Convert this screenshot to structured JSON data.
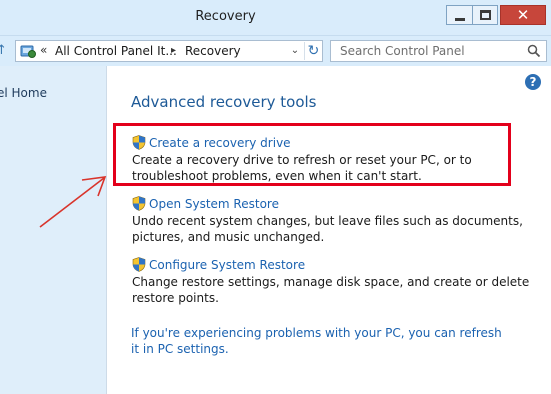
{
  "window": {
    "title": "Recovery",
    "controls": {
      "minimize": "—",
      "maximize": "□",
      "close": "✕"
    }
  },
  "address_bar": {
    "prefix": "«",
    "segments": [
      "All Control Panel It...",
      "Recovery"
    ],
    "separator": "▸",
    "dropdown": "⌄",
    "refresh": "↻",
    "up": "↑"
  },
  "search": {
    "placeholder": "Search Control Panel"
  },
  "left_nav": {
    "home_label": "el Home"
  },
  "main": {
    "help": "?",
    "heading": "Advanced recovery tools",
    "items": [
      {
        "link": "Create a recovery drive",
        "description": "Create a recovery drive to refresh or reset your PC, or to troubleshoot problems, even when it can't start."
      },
      {
        "link": "Open System Restore",
        "description": "Undo recent system changes, but leave files such as documents, pictures, and music unchanged."
      },
      {
        "link": "Configure System Restore",
        "description": "Change restore settings, manage disk space, and create or delete restore points."
      }
    ],
    "footer_link": "If you're experiencing problems with your PC, you can refresh it in PC settings."
  },
  "colors": {
    "accent_link": "#1b62b0",
    "heading": "#1e5a97",
    "highlight_box": "#e3001b",
    "annotation_arrow": "#d9342b",
    "chrome": "#d9ecfb"
  },
  "icons": [
    "control-panel-icon",
    "search-icon",
    "help-icon",
    "uac-shield-icon",
    "refresh-icon",
    "up-arrow-icon"
  ]
}
